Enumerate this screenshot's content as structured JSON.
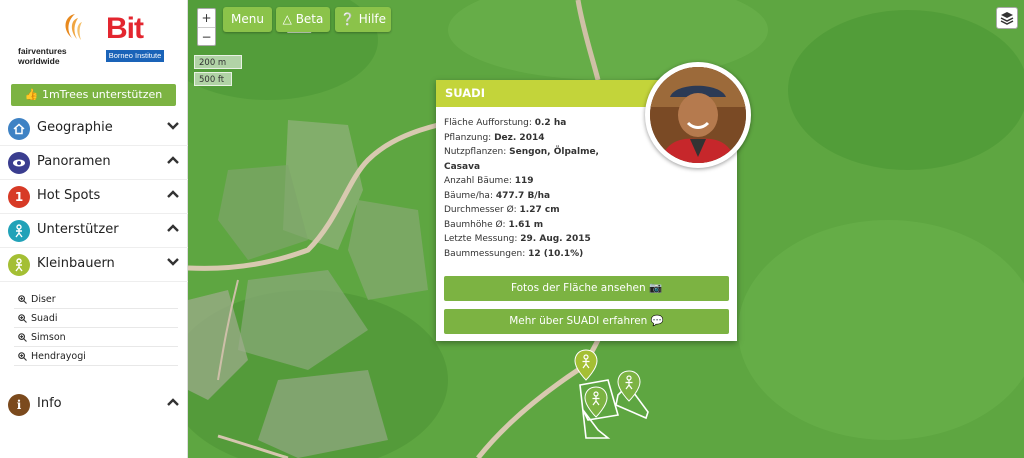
{
  "logos": {
    "fairventures_text": "fairventures\nworldwide",
    "bit_text": "Bit",
    "bit_sub": "Borneo Institute"
  },
  "sidebar": {
    "support_button": "1mTrees unterstützen",
    "items": [
      {
        "label": "Geographie",
        "icon": "home-icon",
        "color": "#3e82c4",
        "chevron": "down"
      },
      {
        "label": "Panoramen",
        "icon": "eye-icon",
        "color": "#3a3d8f",
        "chevron": "up"
      },
      {
        "label": "Hot Spots",
        "icon": "number-one-icon",
        "color": "#d73a26",
        "chevron": "up"
      },
      {
        "label": "Unterstützer",
        "icon": "person-icon",
        "color": "#21a2b8",
        "chevron": "up"
      },
      {
        "label": "Kleinbauern",
        "icon": "farmer-icon",
        "color": "#a4bf34",
        "chevron": "down"
      }
    ],
    "subitems": [
      "Diser",
      "Suadi",
      "Simson",
      "Hendrayogi"
    ],
    "info": {
      "label": "Info",
      "icon": "info-icon",
      "color": "#7b4a1d",
      "chevron": "up"
    }
  },
  "map": {
    "zoom_in": "+",
    "zoom_out": "−",
    "menu_label": "Menu",
    "beta_label": "Beta",
    "help_label": "Hilfe",
    "scale_metric": "200 m",
    "scale_imperial": "500 ft"
  },
  "popup": {
    "title": "SUADI",
    "rows": [
      {
        "label": "Fläche Aufforstung: ",
        "value": "0.2 ha"
      },
      {
        "label": "Pflanzung: ",
        "value": "Dez. 2014"
      },
      {
        "label": "Nutzpflanzen: ",
        "value": "Sengon, Ölpalme,"
      },
      {
        "label": "",
        "value": "Casava"
      },
      {
        "label": "Anzahl Bäume: ",
        "value": "119"
      },
      {
        "label": "Bäume/ha: ",
        "value": "477.7 B/ha"
      },
      {
        "label": "Durchmesser Ø: ",
        "value": "1.27 cm"
      },
      {
        "label": "Baumhöhe Ø: ",
        "value": "1.61 m"
      },
      {
        "label": "Letzte Messung: ",
        "value": "29. Aug. 2015"
      },
      {
        "label": "Baummessungen: ",
        "value": "12 (10.1%)"
      }
    ],
    "photos_button": "Fotos der Fläche ansehen",
    "more_button": "Mehr über SUADI erfahren"
  },
  "colors": {
    "accent_green": "#7cb342",
    "popup_header": "#c3d43a"
  }
}
